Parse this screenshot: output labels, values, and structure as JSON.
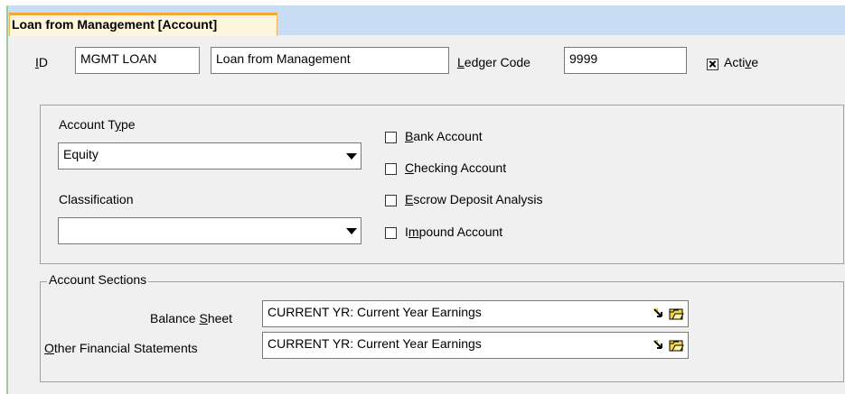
{
  "tab": {
    "title": "Loan from Management  [Account]"
  },
  "header": {
    "id_label_accel": "I",
    "id_label_rest": "D",
    "id_value": "MGMT LOAN",
    "name_value": "Loan from Management",
    "ledger_label_accel": "L",
    "ledger_label_rest": "edger Code",
    "ledger_value": "9999",
    "active_label_pre": "Acti",
    "active_label_accel": "v",
    "active_label_post": "e",
    "active_checked": true
  },
  "account": {
    "type_label_pre": "Account T",
    "type_label_accel": "y",
    "type_label_post": "pe",
    "type_value": "Equity",
    "classification_label": "Classification",
    "classification_value": ""
  },
  "options": [
    {
      "accel": "B",
      "rest": "ank Account",
      "checked": false
    },
    {
      "accel": "C",
      "rest": "hecking Account",
      "checked": false
    },
    {
      "accel": "E",
      "rest": "scrow Deposit Analysis",
      "checked": false
    },
    {
      "pre": "I",
      "accel": "m",
      "rest": "pound Account",
      "checked": false
    }
  ],
  "sections": {
    "legend": "Account Sections",
    "balance_label_pre": "Balance ",
    "balance_label_accel": "S",
    "balance_label_post": "heet",
    "balance_value": "CURRENT YR: Current Year Earnings",
    "other_label_accel": "O",
    "other_label_rest": "ther Financial Statements",
    "other_value": "CURRENT YR: Current Year Earnings"
  }
}
